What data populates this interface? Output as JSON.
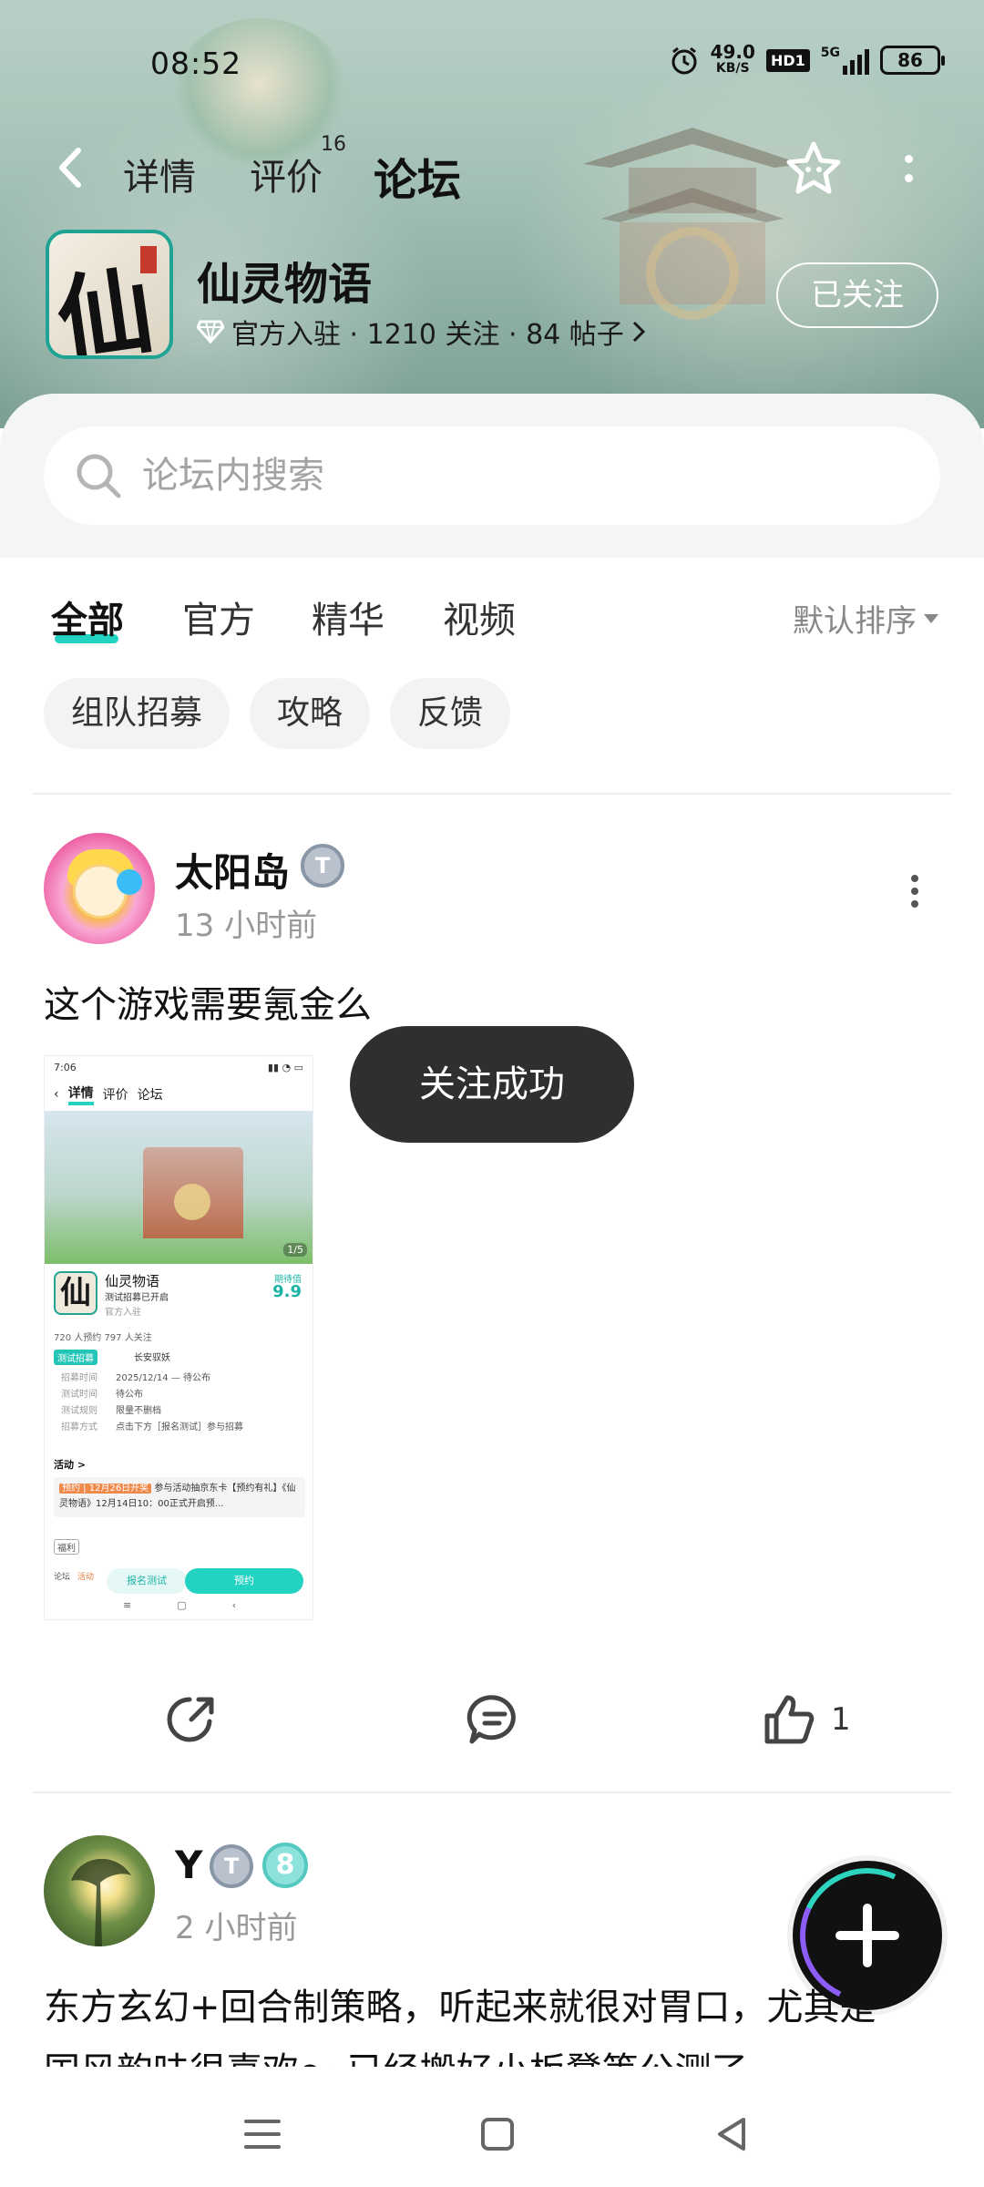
{
  "status_bar": {
    "time": "08:52",
    "net_speed_value": "49.0",
    "net_speed_unit": "KB/S",
    "hd_label": "HD1",
    "signal_label": "5G",
    "battery": "86"
  },
  "top_nav": {
    "tabs": [
      {
        "label": "详情",
        "active": false
      },
      {
        "label": "评价",
        "badge": "16",
        "active": false
      },
      {
        "label": "论坛",
        "active": true
      }
    ],
    "icons": [
      "back-arrow-icon",
      "star-icon",
      "more-vertical-icon"
    ]
  },
  "game": {
    "title": "仙灵物语",
    "icon_glyph": "仙",
    "meta": "官方入驻 · 1210 关注 · 84 帖子",
    "follow_label": "已关注"
  },
  "search": {
    "placeholder": "论坛内搜索"
  },
  "category_tabs": [
    {
      "label": "全部",
      "active": true
    },
    {
      "label": "官方",
      "active": false
    },
    {
      "label": "精华",
      "active": false
    },
    {
      "label": "视频",
      "active": false
    }
  ],
  "sort_label": "默认排序",
  "chips": [
    "组队招募",
    "攻略",
    "反馈"
  ],
  "posts": [
    {
      "username": "太阳岛",
      "badge": "T",
      "time": "13 小时前",
      "text": "这个游戏需要氪金么",
      "like_count": "1"
    },
    {
      "username": "Y",
      "badge": "T",
      "badge2": "8",
      "time": "2 小时前",
      "text_line1": "东方玄幻+回合制策略，听起来就很对胃口，尤其是",
      "text_line2": "国风韵味很喜欢～ 已经搬好小板凳等公测了"
    }
  ],
  "embedded_screenshot": {
    "status_time": "7:06",
    "nav_detail": "详情",
    "nav_review": "评价",
    "nav_forum": "论坛",
    "page_indicator": "1/5",
    "game_name": "仙灵物语",
    "game_sub": "测试招募已开启",
    "official": "官方入驻",
    "score_label": "期待值",
    "score": "9.9",
    "counts": "720 人预约   797 人关注",
    "tag": "测试招募",
    "tag2": "长安驭妖",
    "rows": [
      {
        "k": "招募时间",
        "v": "2025/12/14 — 待公布"
      },
      {
        "k": "测试时间",
        "v": "待公布"
      },
      {
        "k": "测试规则",
        "v": "限量不删档"
      },
      {
        "k": "招募方式",
        "v": "点击下方［报名测试］参与招募"
      }
    ],
    "activity": "活动 >",
    "activity_tag": "预约 | 12月26日开奖",
    "activity_text": "参与活动抽京东卡【预约有礼】《仙灵物语》12月14日10：00正式开启预...",
    "fu_label": "福利",
    "bottom_forum": "论坛",
    "bottom_activity": "活动",
    "btn_signup": "报名测试",
    "btn_reserve": "预约"
  },
  "toast": "关注成功",
  "colors": {
    "accent": "#23d3c2",
    "toast_bg": "#2f2f2f"
  }
}
